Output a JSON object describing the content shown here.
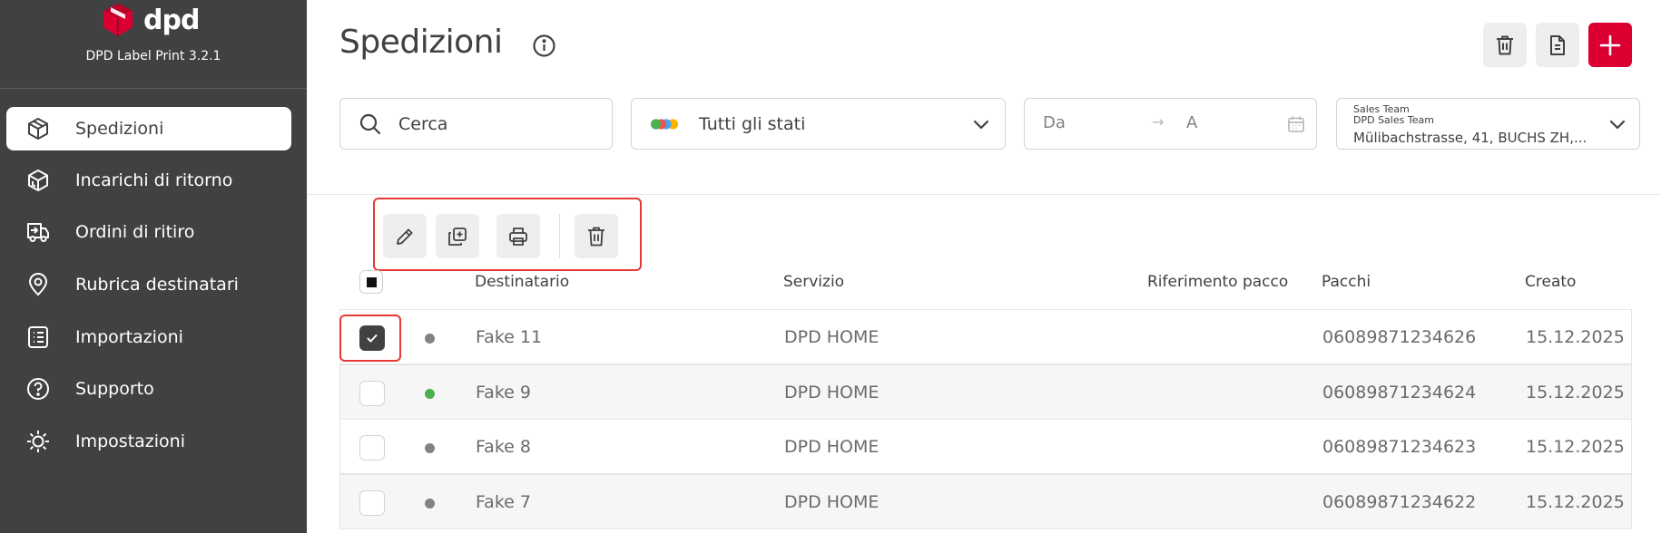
{
  "app": {
    "logo_text": "dpd",
    "version": "DPD Label Print 3.2.1",
    "brand_color": "#dc0032",
    "sidebar_bg": "#414042"
  },
  "sidebar": {
    "items": [
      {
        "label": "Spedizioni",
        "icon": "package-icon",
        "active": true
      },
      {
        "label": "Incarichi di ritorno",
        "icon": "return-package-icon",
        "active": false
      },
      {
        "label": "Ordini di ritiro",
        "icon": "truck-icon",
        "active": false
      },
      {
        "label": "Rubrica destinatari",
        "icon": "location-pin-icon",
        "active": false
      },
      {
        "label": "Importazioni",
        "icon": "list-icon",
        "active": false
      },
      {
        "label": "Supporto",
        "icon": "help-circle-icon",
        "active": false
      },
      {
        "label": "Impostazioni",
        "icon": "gear-icon",
        "active": false
      }
    ]
  },
  "header": {
    "title": "Spedizioni",
    "info_icon": "info-icon",
    "buttons": [
      {
        "name": "delete-all-button",
        "icon": "trash-icon"
      },
      {
        "name": "document-button",
        "icon": "document-icon"
      },
      {
        "name": "add-shipment-button",
        "icon": "plus-icon"
      }
    ]
  },
  "filters": {
    "search_placeholder": "Cerca",
    "status_label": "Tutti gli stati",
    "status_dot_colors": [
      "#4caf50",
      "#ef5350",
      "#42a5f5",
      "#ffb300"
    ],
    "date_from": "Da",
    "date_arrow": "→",
    "date_to": "A",
    "address_line1": "Sales Team",
    "address_line2": "DPD Sales Team",
    "address_line3": "Mülibachstrasse, 41, BUCHS ZH,..."
  },
  "actions": [
    {
      "name": "edit-button",
      "icon": "pencil-icon"
    },
    {
      "name": "duplicate-button",
      "icon": "duplicate-icon"
    },
    {
      "name": "print-button",
      "icon": "printer-icon"
    },
    {
      "name": "delete-button",
      "icon": "trash-icon"
    }
  ],
  "table": {
    "columns": [
      "Destinatario",
      "Servizio",
      "Riferimento pacco",
      "Pacchi",
      "Creato"
    ],
    "rows": [
      {
        "checked": true,
        "status_color": "#808285",
        "recipient": "Fake 11",
        "service": "DPD HOME",
        "reference": "",
        "parcels": "06089871234626",
        "created": "15.12.2025"
      },
      {
        "checked": false,
        "status_color": "#4caf50",
        "recipient": "Fake 9",
        "service": "DPD HOME",
        "reference": "",
        "parcels": "06089871234624",
        "created": "15.12.2025"
      },
      {
        "checked": false,
        "status_color": "#808285",
        "recipient": "Fake 8",
        "service": "DPD HOME",
        "reference": "",
        "parcels": "06089871234623",
        "created": "15.12.2025"
      },
      {
        "checked": false,
        "status_color": "#808285",
        "recipient": "Fake 7",
        "service": "DPD HOME",
        "reference": "",
        "parcels": "06089871234622",
        "created": "15.12.2025"
      }
    ]
  }
}
